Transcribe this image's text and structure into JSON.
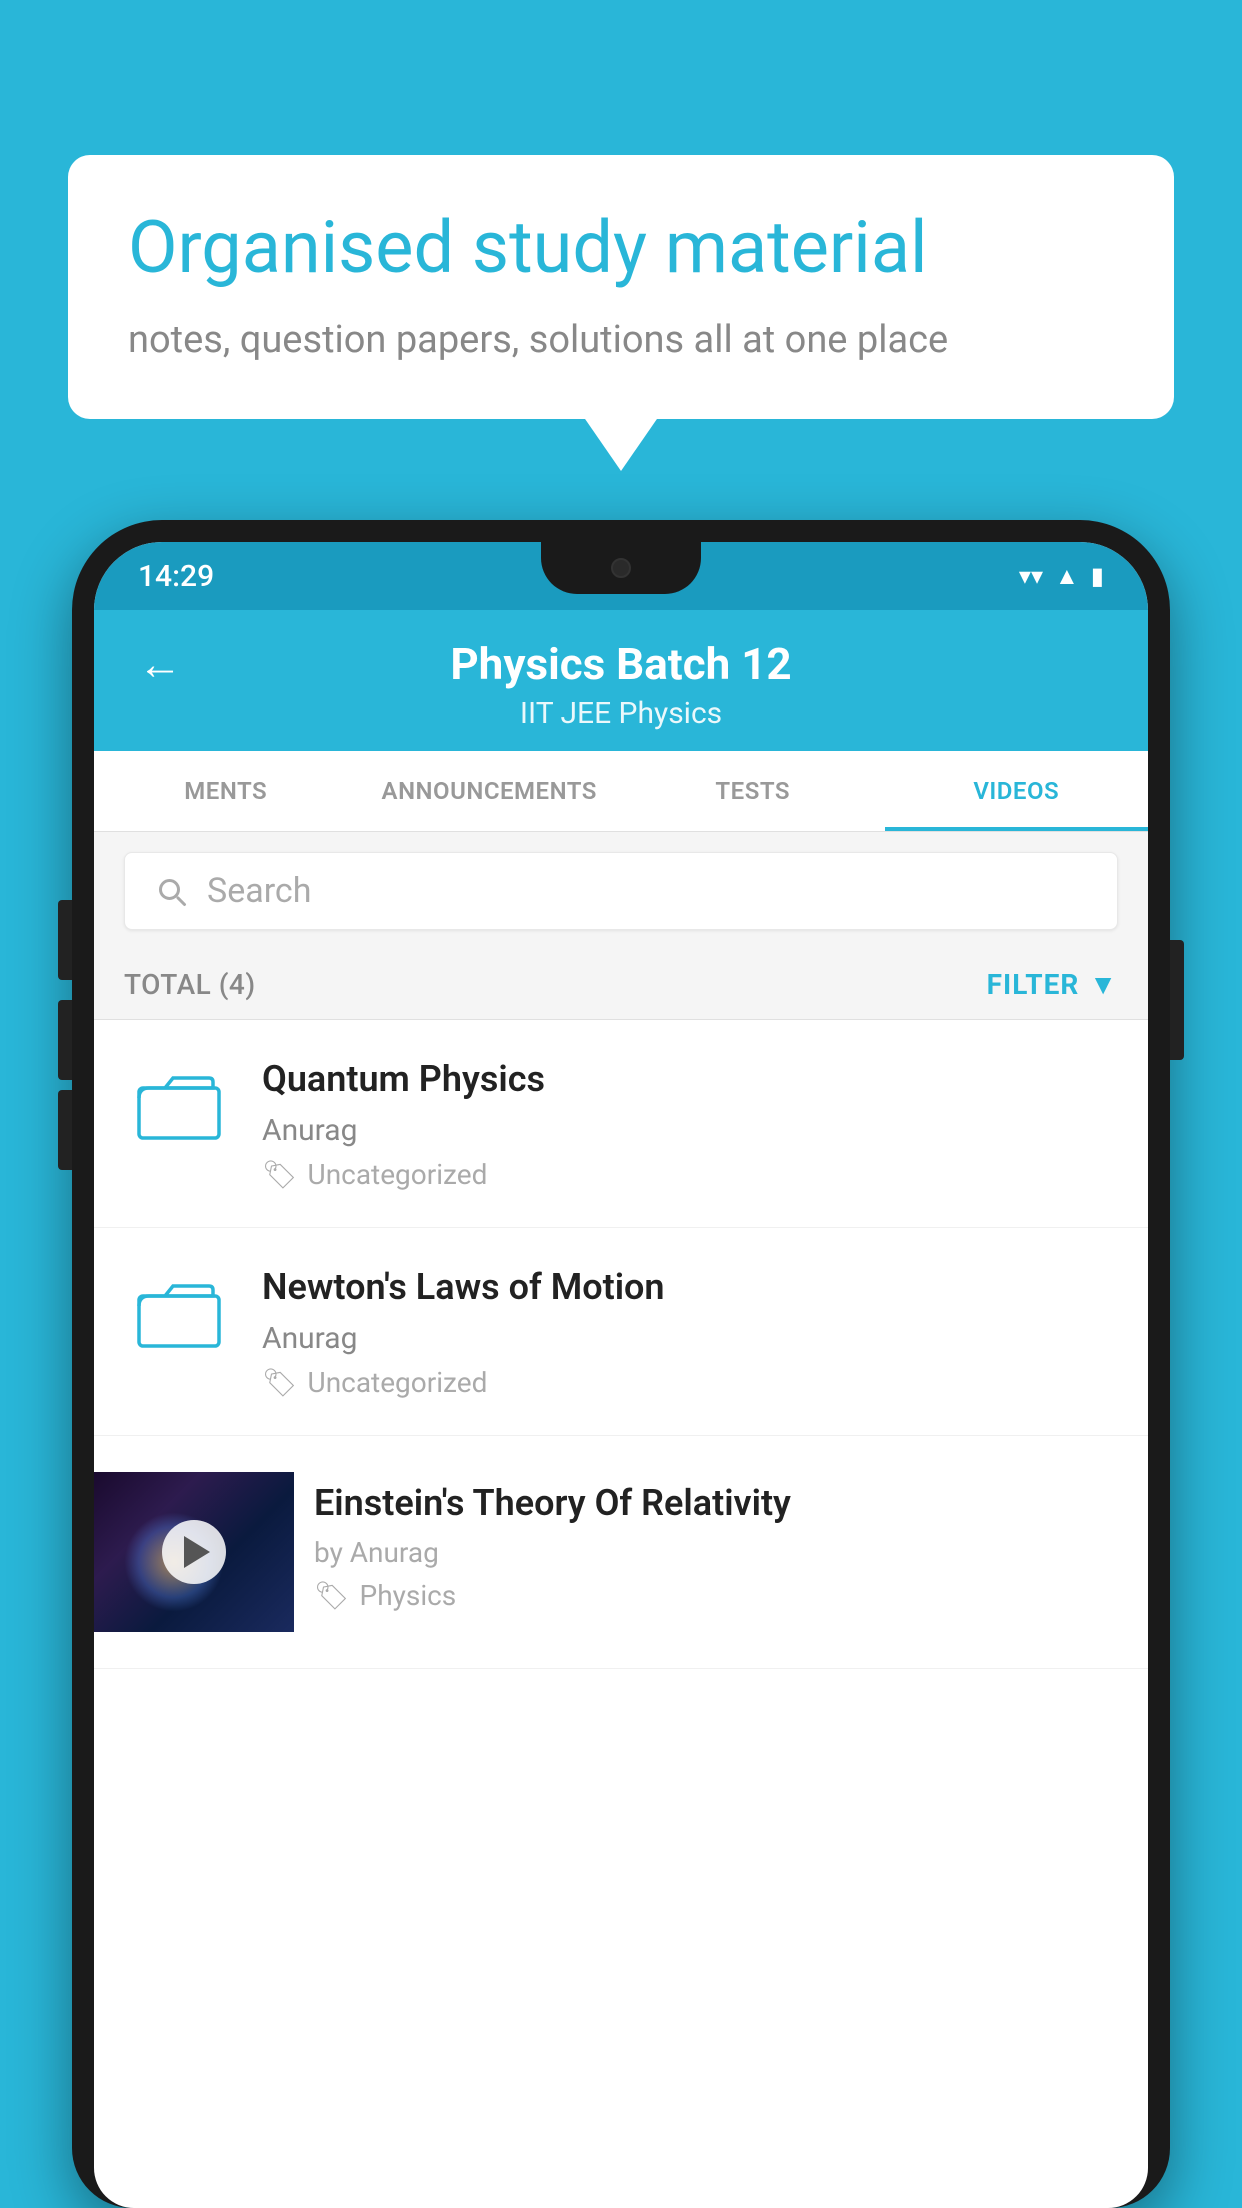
{
  "background": {
    "color": "#29b6d8"
  },
  "speech_bubble": {
    "heading": "Organised study material",
    "subtext": "notes, question papers, solutions all at one place"
  },
  "phone": {
    "status_bar": {
      "time": "14:29",
      "icons": [
        "wifi",
        "signal",
        "battery"
      ]
    },
    "header": {
      "back_label": "←",
      "title": "Physics Batch 12",
      "subtitle": "IIT JEE   Physics"
    },
    "tabs": [
      {
        "label": "MENTS",
        "active": false
      },
      {
        "label": "ANNOUNCEMENTS",
        "active": false
      },
      {
        "label": "TESTS",
        "active": false
      },
      {
        "label": "VIDEOS",
        "active": true
      }
    ],
    "search": {
      "placeholder": "Search"
    },
    "filter": {
      "total_label": "TOTAL (4)",
      "filter_label": "FILTER"
    },
    "videos": [
      {
        "id": 1,
        "title": "Quantum Physics",
        "author": "Anurag",
        "tag": "Uncategorized",
        "has_thumbnail": false
      },
      {
        "id": 2,
        "title": "Newton's Laws of Motion",
        "author": "Anurag",
        "tag": "Uncategorized",
        "has_thumbnail": false
      },
      {
        "id": 3,
        "title": "Einstein's Theory Of Relativity",
        "author": "by Anurag",
        "tag": "Physics",
        "has_thumbnail": true
      }
    ]
  }
}
